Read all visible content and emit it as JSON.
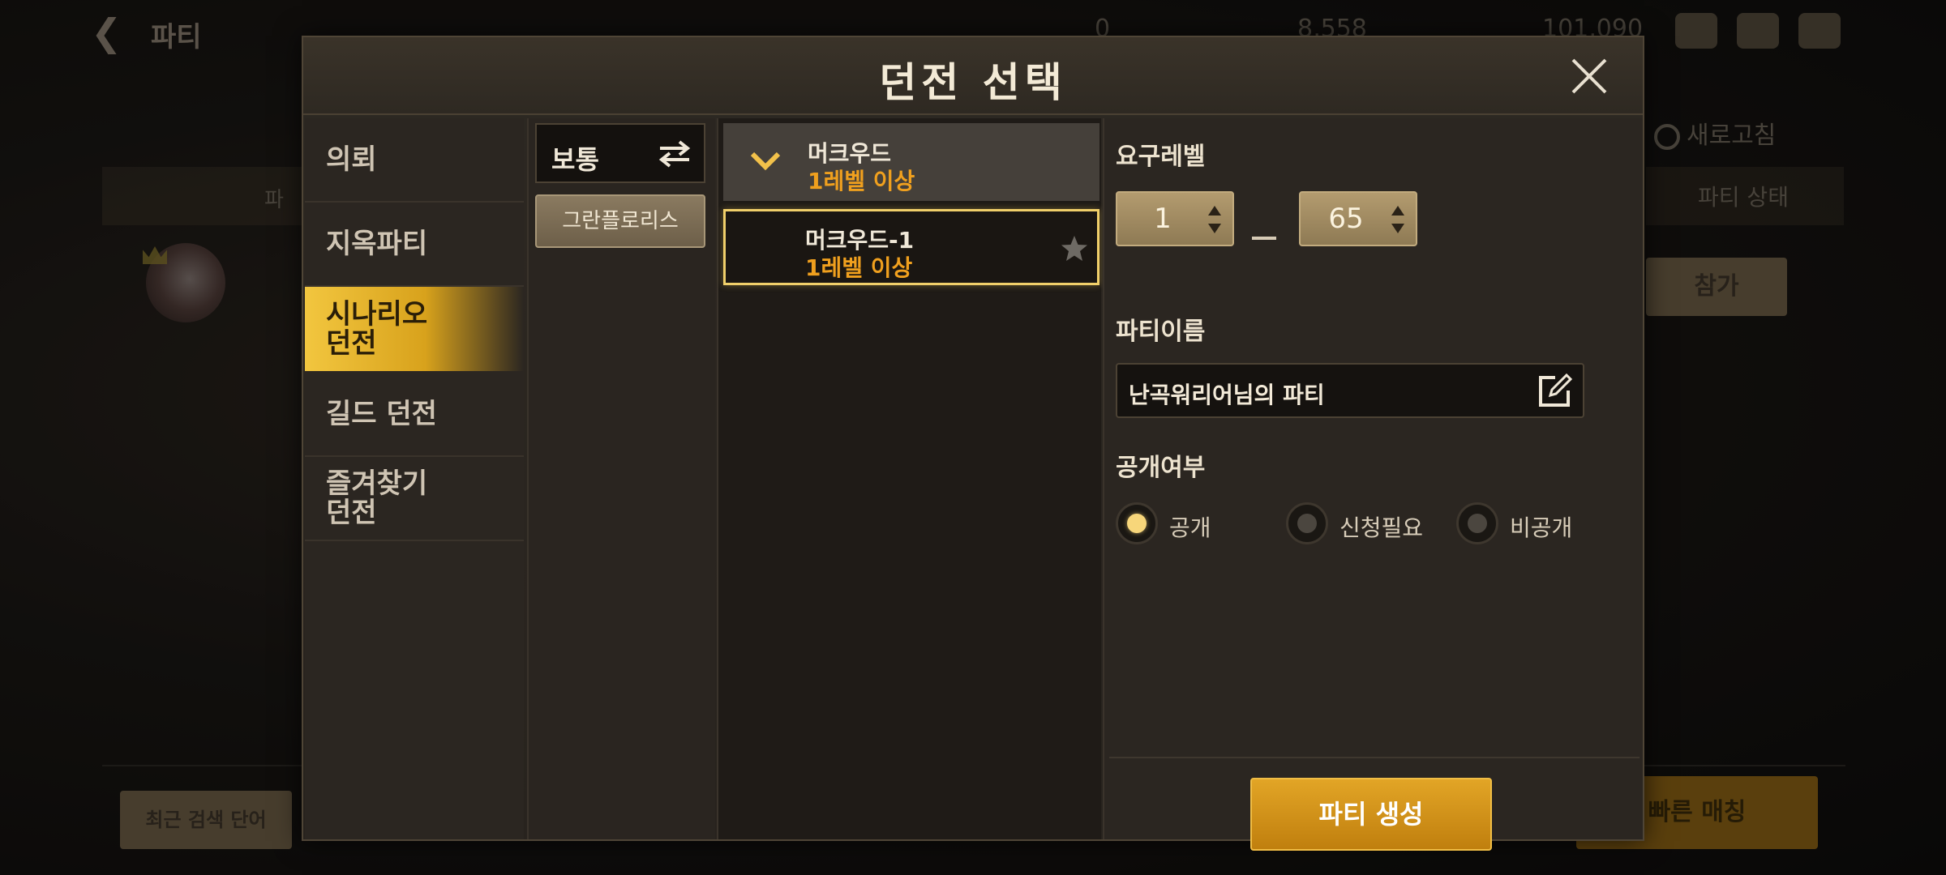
{
  "background": {
    "top_title": "파티",
    "currencies": [
      "0",
      "8,558",
      "101,090"
    ],
    "refresh_label": "새로고침",
    "party_state_header": "파티 상태",
    "header_left": "파",
    "join_label": "참가",
    "recent_search_label": "최근 검색 단어",
    "quick_match_label": "빠른 매칭",
    "party_name_placeholder": "파티이름"
  },
  "modal": {
    "title": "던전 선택",
    "categories": [
      {
        "label": "의뢰",
        "active": false
      },
      {
        "label": "지옥파티",
        "active": false
      },
      {
        "label": "시나리오\n던전",
        "active": true
      },
      {
        "label": "길드 던전",
        "active": false
      },
      {
        "label": "즐겨찾기\n던전",
        "active": false
      }
    ],
    "difficulty": {
      "label": "보통"
    },
    "region": {
      "label": "그란플로리스"
    },
    "dungeon_group": {
      "name": "머크우드",
      "level": "1레벨 이상"
    },
    "dungeon_item": {
      "name": "머크우드-1",
      "level": "1레벨 이상"
    },
    "settings": {
      "required_level_label": "요구레벨",
      "level_min": "1",
      "level_max": "65",
      "party_name_label": "파티이름",
      "party_name_value": "난곡워리어님의 파티",
      "visibility_label": "공개여부",
      "visibility_options": [
        {
          "label": "공개",
          "selected": true
        },
        {
          "label": "신청필요",
          "selected": false
        },
        {
          "label": "비공개",
          "selected": false
        }
      ],
      "create_button_label": "파티 생성"
    }
  },
  "colors": {
    "accent_gold": "#f0a01e",
    "active_tab": "#f2c63f",
    "create_button": "#d6961c"
  }
}
